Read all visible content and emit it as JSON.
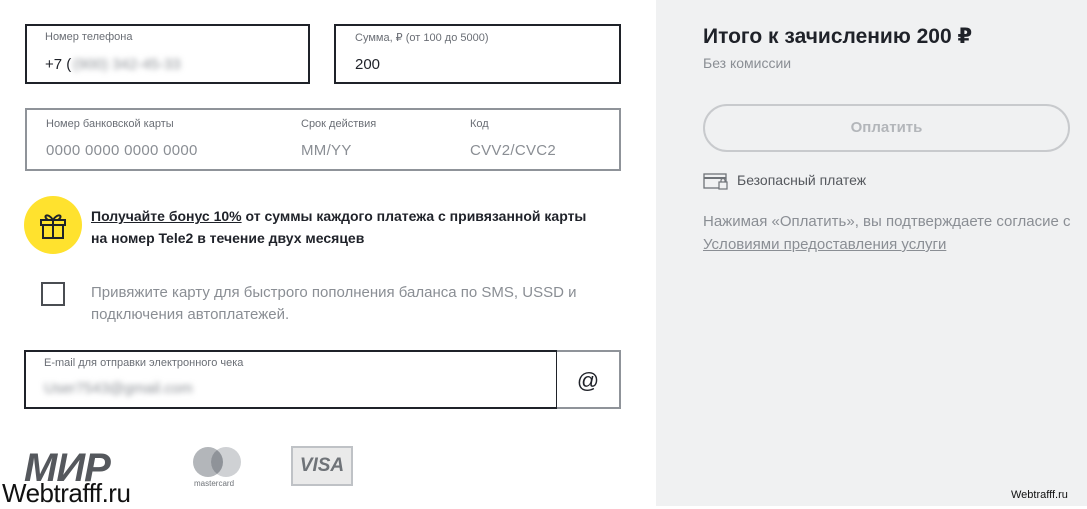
{
  "phone": {
    "label": "Номер телефона",
    "prefix": "+7 (",
    "value": "(900) 342-45-33"
  },
  "amount": {
    "label": "Сумма, ₽ (от 100 до 5000)",
    "value": "200"
  },
  "card": {
    "number_label": "Номер банковской карты",
    "number_placeholder": "0000 0000 0000 0000",
    "expiry_label": "Срок действия",
    "expiry_placeholder": "MM/YY",
    "code_label": "Код",
    "code_placeholder": "CVV2/CVC2"
  },
  "bonus": {
    "link_text": "Получайте бонус 10%",
    "text": " от суммы каждого платежа с привязанной карты на номер Tele2 в течение двух месяцев"
  },
  "bind_card": {
    "text": "Привяжите карту для быстрого пополнения баланса по SMS, USSD и подключения автоплатежей.",
    "checked": false
  },
  "email": {
    "label": "E-mail для отправки электронного чека",
    "value": "User7543@gmail.com",
    "button_symbol": "@"
  },
  "payment_systems": {
    "mir": "МИР",
    "mastercard": "mastercard",
    "visa": "VISA"
  },
  "watermark": {
    "left": "Webtrafff.ru",
    "right": "Webtrafff.ru"
  },
  "summary": {
    "title": "Итого к зачислению 200 ₽",
    "subtitle": "Без комиссии",
    "pay_button": "Оплатить",
    "secure_text": "Безопасный платеж",
    "terms_text": "Нажимая «Оплатить», вы подтверждаете согласие с ",
    "terms_link": "Условиями предоставления услуги"
  }
}
